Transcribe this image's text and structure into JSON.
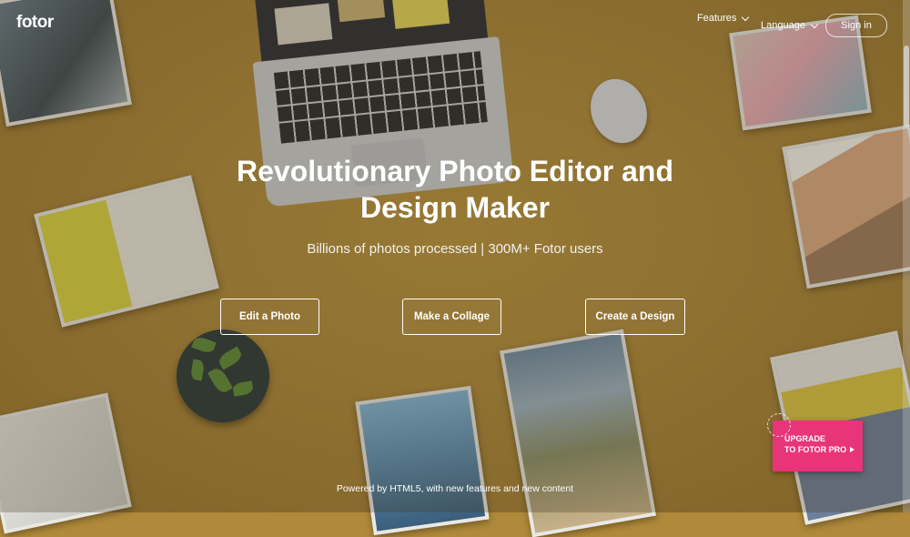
{
  "header": {
    "logo": "fotor",
    "nav": {
      "features": "Features",
      "language": "Language",
      "signin": "Sign in"
    }
  },
  "hero": {
    "title": "Revolutionary Photo Editor and Design Maker",
    "subtitle": "Billions of photos processed | 300M+ Fotor users",
    "buttons": {
      "edit_photo": "Edit a Photo",
      "make_collage": "Make a Collage",
      "create_design": "Create a Design"
    }
  },
  "footer_note": "Powered by HTML5, with new features and new content",
  "upgrade": {
    "line1": "UPGRADE",
    "line2": "TO FOTOR PRO"
  },
  "colors": {
    "background": "#b08a3a",
    "upgrade_badge": "#e8357a"
  }
}
